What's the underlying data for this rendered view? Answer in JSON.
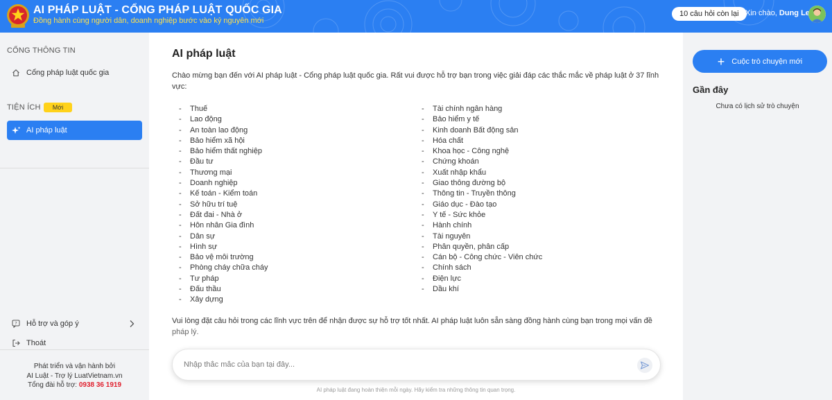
{
  "header": {
    "title": "AI PHÁP LUẬT - CỔNG PHÁP LUẬT QUỐC GIA",
    "subtitle": "Đồng hành cùng người dân, doanh nghiệp bước vào kỷ nguyên mới",
    "quota": "10 câu hỏi còn lại",
    "greeting_prefix": "Xin chào, ",
    "user_name": "Dung Le",
    "colors": {
      "primary": "#2b7ff2",
      "subtitle": "#ffe14d"
    }
  },
  "sidebar": {
    "section1_label": "CỔNG THÔNG TIN",
    "portal_item": "Cổng pháp luật quốc gia",
    "section2_label": "TIỆN ÍCH",
    "new_badge": "Mới",
    "ai_item": "AI pháp luật",
    "support_item": "Hỗ trợ và góp ý",
    "logout_item": "Thoát",
    "footer_line1": "Phát triển và vận hành bởi",
    "footer_line2": "AI Luật - Trợ lý LuatVietnam.vn",
    "footer_hotline_label": "Tổng đài hỗ trợ: ",
    "footer_hotline": "0938 36 1919"
  },
  "main": {
    "title": "AI pháp luật",
    "intro": "Chào mừng bạn đến với AI pháp luật - Cổng pháp luật quốc gia. Rất vui được hỗ trợ bạn trong việc giải đáp các thắc mắc về pháp luật ở 37 lĩnh vực:",
    "fields_col1": [
      "Thuế",
      "Lao động",
      "An toàn lao động",
      "Bảo hiểm xã hội",
      "Bảo hiểm thất nghiệp",
      "Đầu tư",
      "Thương mại",
      "Doanh nghiệp",
      "Kế toán - Kiểm toán",
      "Sở hữu trí tuệ",
      "Đất đai - Nhà ở",
      "Hôn nhân Gia đình",
      "Dân sự",
      "Hình sự",
      "Bảo vệ môi trường",
      "Phòng cháy chữa cháy",
      "Tư pháp",
      "Đấu thầu",
      "Xây dựng"
    ],
    "fields_col2": [
      "Tài chính ngân hàng",
      "Bảo hiểm y tế",
      "Kinh doanh Bất động sản",
      "Hóa chất",
      "Khoa học - Công nghệ",
      "Chứng khoán",
      "Xuất nhập khẩu",
      "Giao thông đường bộ",
      "Thông tin - Truyền thông",
      "Giáo dục - Đào tạo",
      "Y tế - Sức khỏe",
      "Hành chính",
      "Tài nguyên",
      "Phân quyền, phân cấp",
      "Cán bộ - Công chức - Viên chức",
      "Chính sách",
      "Điện lực",
      "Dầu khí"
    ],
    "outro_main": "Vui lòng đặt câu hỏi trong các lĩnh vực trên để nhận được sự hỗ trợ tốt nhất. AI pháp luật luôn sẵn sàng đồng hành cùng bạn trong mọi vấn đề",
    "outro_tail": "pháp lý.",
    "input_placeholder": "Nhập thắc mắc của bạn tại đây...",
    "disclaimer": "AI pháp luật đang hoàn thiện mỗi ngày. Hãy kiểm tra những thông tin quan trọng."
  },
  "right": {
    "new_chat": "Cuộc trò chuyện mới",
    "recent_title": "Gần đây",
    "no_history": "Chưa có lịch sử trò chuyện"
  }
}
